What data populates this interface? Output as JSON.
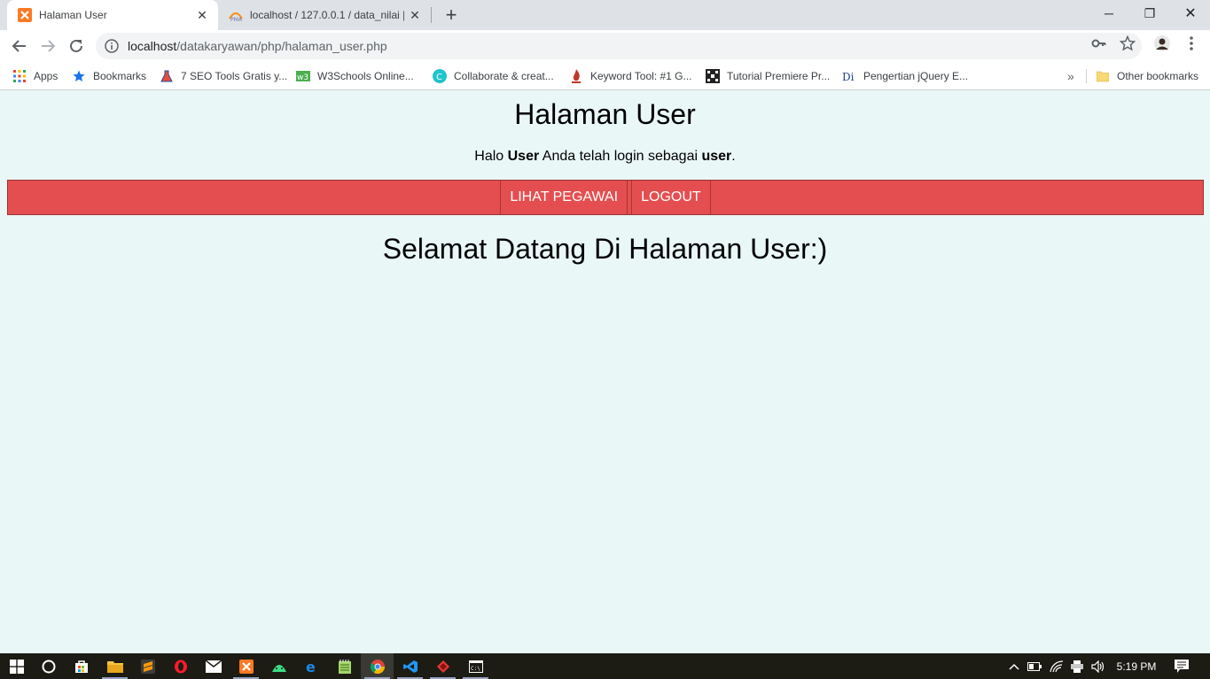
{
  "browser": {
    "tabs": [
      {
        "title": "Halaman User",
        "icon": "xampp-icon",
        "active": true
      },
      {
        "title": "localhost / 127.0.0.1 / data_nilai |",
        "icon": "phpmyadmin-icon",
        "active": false
      }
    ],
    "new_tab": "+",
    "window_controls": {
      "minimize": "─",
      "restore": "❐",
      "close": "✕"
    },
    "address": {
      "host": "localhost",
      "path": "/datakaryawan/php/halaman_user.php"
    },
    "bookmarks": [
      {
        "label": "Apps",
        "icon": "apps-grid-icon"
      },
      {
        "label": "Bookmarks",
        "icon": "star-icon"
      },
      {
        "label": "7 SEO Tools Gratis y...",
        "icon": "flask-icon"
      },
      {
        "label": "W3Schools Online...",
        "icon": "w3schools-icon"
      },
      {
        "label": "Collaborate & creat...",
        "icon": "canva-icon"
      },
      {
        "label": "Keyword Tool: #1 G...",
        "icon": "flame-icon"
      },
      {
        "label": "Tutorial Premiere Pr...",
        "icon": "film-icon"
      },
      {
        "label": "Pengertian jQuery E...",
        "icon": "di-icon"
      }
    ],
    "more_bookmarks": "»",
    "other_bookmarks": "Other bookmarks"
  },
  "page": {
    "title": "Halaman User",
    "greeting": {
      "prefix": "Halo ",
      "name": "User",
      "middle": " Anda telah login sebagai ",
      "role": "user",
      "suffix": "."
    },
    "nav": [
      {
        "label": "LIHAT PEGAWAI"
      },
      {
        "label": "LOGOUT"
      }
    ],
    "welcome": "Selamat Datang Di Halaman User:)"
  },
  "taskbar": {
    "apps": [
      "start-icon",
      "cortana-icon",
      "store-icon",
      "file-explorer-icon",
      "sublime-icon",
      "opera-icon",
      "mail-icon",
      "xampp-icon",
      "android-studio-icon",
      "edge-icon",
      "notepad-icon",
      "chrome-icon",
      "vscode-icon",
      "app-red-icon",
      "cmd-icon"
    ],
    "clock": "5:19 PM"
  },
  "colors": {
    "page_bg": "#eaf7f7",
    "nav_bg": "#e54e50",
    "nav_text": "#ffffff"
  }
}
